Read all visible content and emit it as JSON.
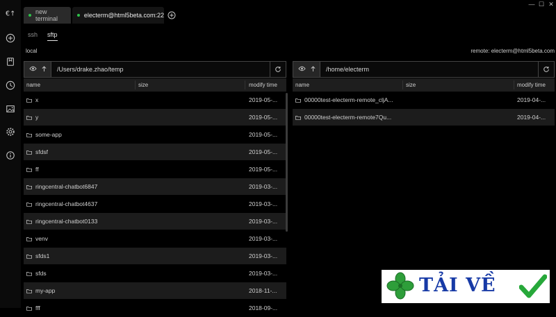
{
  "sidebar": {
    "items": [
      {
        "icon": "electerm-logo-icon"
      },
      {
        "icon": "add-circle-icon"
      },
      {
        "icon": "bookmark-icon"
      },
      {
        "icon": "history-icon"
      },
      {
        "icon": "image-icon"
      },
      {
        "icon": "gear-icon"
      },
      {
        "icon": "info-icon"
      }
    ]
  },
  "tabs": [
    {
      "label": "new terminal",
      "status_color": "#2fc14a"
    },
    {
      "label": "electerm@html5beta.com:22",
      "status_color": "#2fc14a"
    }
  ],
  "window_controls": [
    "—",
    "☐",
    "✕"
  ],
  "modes": [
    "ssh",
    "sftp"
  ],
  "active_mode": "sftp",
  "local": {
    "header": "local",
    "path": "/Users/drake.zhao/temp",
    "columns": [
      "name",
      "size",
      "modify time"
    ],
    "files": [
      {
        "name": "x",
        "modified": "2019-05-..."
      },
      {
        "name": "y",
        "modified": "2019-05-..."
      },
      {
        "name": "some-app",
        "modified": "2019-05-..."
      },
      {
        "name": "sfdsf",
        "modified": "2019-05-..."
      },
      {
        "name": "ff",
        "modified": "2019-05-..."
      },
      {
        "name": "ringcentral-chatbot6847",
        "modified": "2019-03-..."
      },
      {
        "name": "ringcentral-chatbot4637",
        "modified": "2019-03-..."
      },
      {
        "name": "ringcentral-chatbot0133",
        "modified": "2019-03-..."
      },
      {
        "name": "venv",
        "modified": "2019-03-..."
      },
      {
        "name": "sfds1",
        "modified": "2019-03-..."
      },
      {
        "name": "sfds",
        "modified": "2019-03-..."
      },
      {
        "name": "my-app",
        "modified": "2018-11-..."
      },
      {
        "name": "fff",
        "modified": "2018-09-..."
      }
    ]
  },
  "remote": {
    "header": "remote: electerm@html5beta.com",
    "path": "/home/electerm",
    "columns": [
      "name",
      "size",
      "modify time"
    ],
    "files": [
      {
        "name": "00000test-electerm-remote_cljA...",
        "modified": "2019-04-..."
      },
      {
        "name": "00000test-electerm-remote7Qu...",
        "modified": "2019-04-..."
      }
    ]
  },
  "watermark": {
    "text": "TẢI VỀ",
    "leaf_color": "#2e9e3a",
    "check_color": "#27a83a"
  },
  "colors": {
    "background": "#000000",
    "row_alt": "#1c1c1c",
    "header": "#1e1e1e",
    "status": "#2fc14a"
  }
}
